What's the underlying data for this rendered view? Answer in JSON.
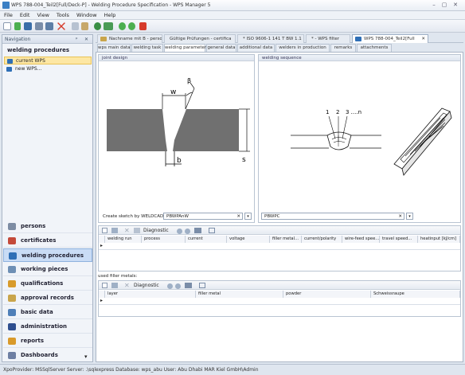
{
  "window": {
    "title": "WPS 788-004_Teil2[Full/Deck-P] - Welding Procedure Specification - WPS Manager 5",
    "controls": [
      "–",
      "▢",
      "✕"
    ]
  },
  "menu": [
    "File",
    "Edit",
    "View",
    "Tools",
    "Window",
    "Help"
  ],
  "navigation": {
    "header": "Navigation",
    "pin": "ᵖ",
    "close": "✕",
    "section": "welding procedures",
    "items": [
      "current WPS",
      "new WPS..."
    ],
    "bottom": [
      "persons",
      "certificates",
      "welding procedures",
      "working pieces",
      "qualifications",
      "approval records",
      "basic data",
      "administration",
      "reports",
      "Dashboards"
    ],
    "more": "▾",
    "icon_colors": [
      "#7d8ca3",
      "#c44a3a",
      "#2f6fb6",
      "#6e8fb5",
      "#d89b2b",
      "#c9a54b",
      "#4f7fb8",
      "#2f4f8f",
      "#d99a2b",
      "#6e7fa3"
    ]
  },
  "doc_tabs": [
    {
      "label": "Nachname mit B - perso",
      "color": "#c9a54b"
    },
    {
      "label": "Gültige Prüfungen - certifica",
      "color": "#c44a3a"
    },
    {
      "label": "* ISO 9606-1 141 T BW 1.1",
      "color": "#6e8fb5"
    },
    {
      "label": "* - WPS filter",
      "color": "#6e8fb5"
    },
    {
      "label": "WPS 788-004_Teil2[Full",
      "color": "#2f6fb6"
    }
  ],
  "doc_tab_close": "✕",
  "sub_tabs": [
    "wps main data",
    "welding task",
    "welding parameter",
    "general data",
    "additional data",
    "welders in production",
    "remarks",
    "attachments"
  ],
  "joint_design": {
    "title": "joint design",
    "labels": {
      "beta": "β",
      "w": "w",
      "b": "b",
      "s": "s"
    },
    "combo_label": "Create sketch by WELDCAD",
    "combo_value": "PBWPAnW"
  },
  "welding_sequence": {
    "title": "welding sequence",
    "labels": [
      "1",
      "2",
      "3 ....n"
    ],
    "combo_value": "PBWPC"
  },
  "grid_toolbar": {
    "diagnostic": "Diagnostic"
  },
  "passes_table": {
    "columns": [
      "welding run",
      "process",
      "current",
      "voltage",
      "filler metal...",
      "current/polarity",
      "wire-feed spee...",
      "travel speed...",
      "heatinput [kJ/cm]"
    ]
  },
  "filler": {
    "label": "used filler metals:",
    "columns": [
      "layer",
      "filler metal",
      "powder",
      "Schweissraupe"
    ]
  },
  "row_marker": "▸",
  "status": "XpoProvider: MSSqlServer   Server: .\\sqlexpress   Database: wps_abu   User: Abu Dhabi MAR Kiel GmbH\\Admin"
}
